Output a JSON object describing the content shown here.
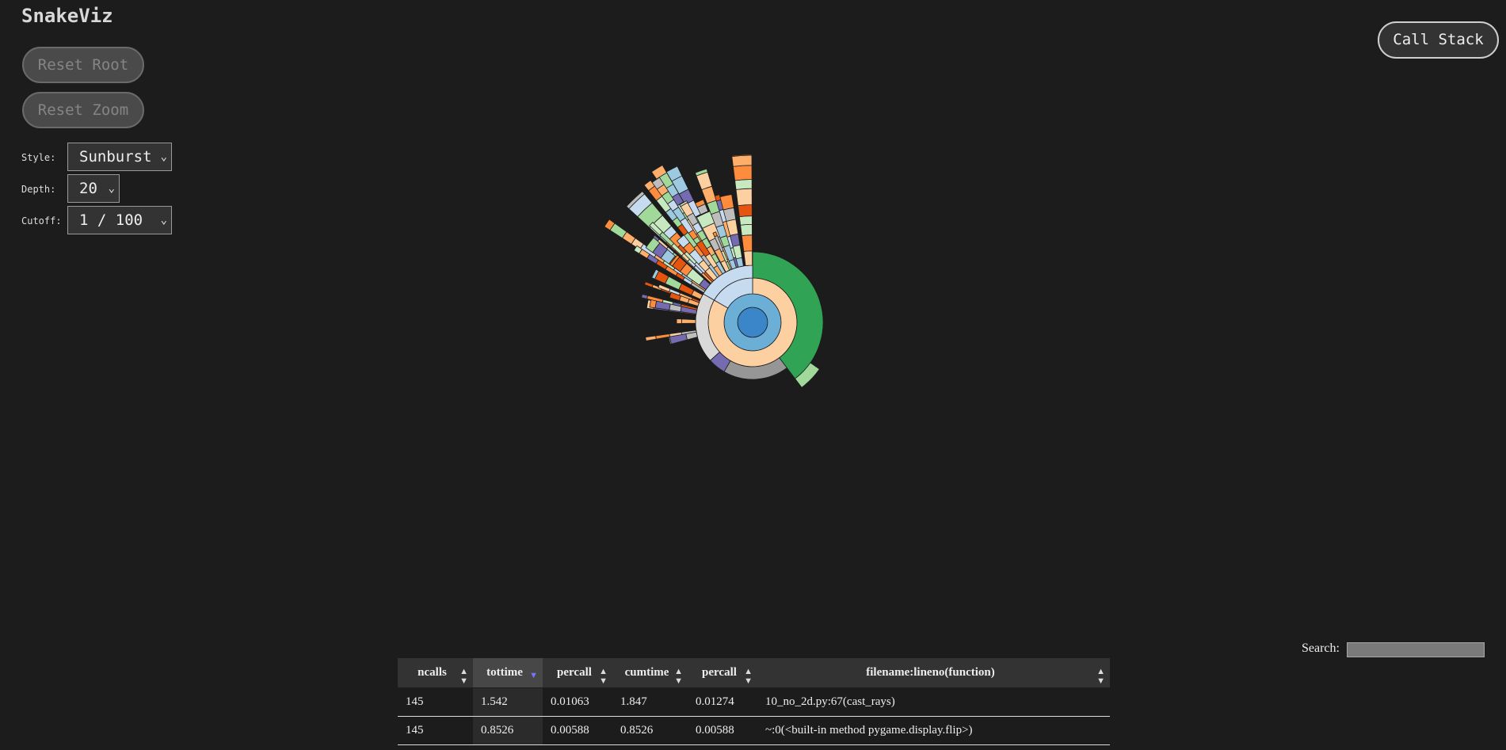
{
  "app": {
    "title": "SnakeViz"
  },
  "controls": {
    "reset_root_label": "Reset Root",
    "reset_zoom_label": "Reset Zoom",
    "call_stack_label": "Call Stack",
    "style_label": "Style:",
    "style_value": "Sunburst",
    "depth_label": "Depth:",
    "depth_value": "20",
    "cutoff_label": "Cutoff:",
    "cutoff_value": "1 / 100"
  },
  "search": {
    "label": "Search:",
    "value": ""
  },
  "table": {
    "headers": [
      "ncalls",
      "tottime",
      "percall",
      "cumtime",
      "percall",
      "filename:lineno(function)"
    ],
    "sorted_column": 1,
    "rows": [
      [
        "145",
        "1.542",
        "0.01063",
        "1.847",
        "0.01274",
        "10_no_2d.py:67(cast_rays)"
      ],
      [
        "145",
        "0.8526",
        "0.00588",
        "0.8526",
        "0.00588",
        "~:0(<built-in method pygame.display.flip>)"
      ]
    ]
  },
  "colors": {
    "background": "#1c1c1c",
    "sort_active": "#7b74ff",
    "palette": [
      "#3a86c8",
      "#6baed6",
      "#9ecae1",
      "#c6dbef",
      "#fdd0a2",
      "#fdae6b",
      "#fd8d3c",
      "#e6550d",
      "#31a354",
      "#74c476",
      "#a1d99b",
      "#c7e9c0",
      "#969696",
      "#bdbdbd",
      "#d9d9d9",
      "#756bb1",
      "#9e9ac8"
    ]
  }
}
